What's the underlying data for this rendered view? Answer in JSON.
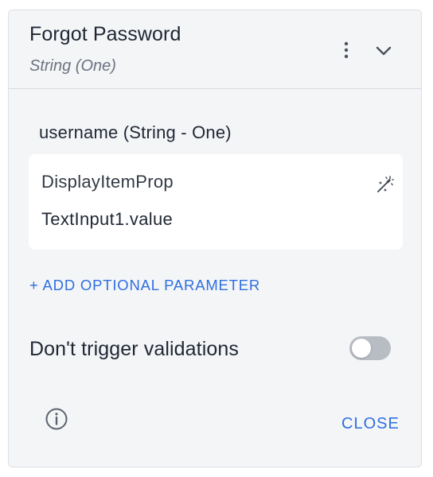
{
  "header": {
    "title": "Forgot Password",
    "subtitle": "String (One)",
    "more_icon": "more-vertical-icon",
    "collapse_icon": "chevron-down-icon"
  },
  "parameter": {
    "label": "username (String - One)",
    "prop_type": "DisplayItemProp",
    "value": "TextInput1.value",
    "wand_icon": "magic-wand-icon"
  },
  "add_optional_parameter": "+ ADD OPTIONAL PARAMETER",
  "validations": {
    "label": "Don't trigger validations",
    "enabled": false
  },
  "footer": {
    "info_icon": "info-icon",
    "close_label": "CLOSE"
  },
  "colors": {
    "accent": "#2f6fe0",
    "text": "#1f2733",
    "background": "#f4f5f7",
    "toggle_off": "#b8bcc3"
  }
}
